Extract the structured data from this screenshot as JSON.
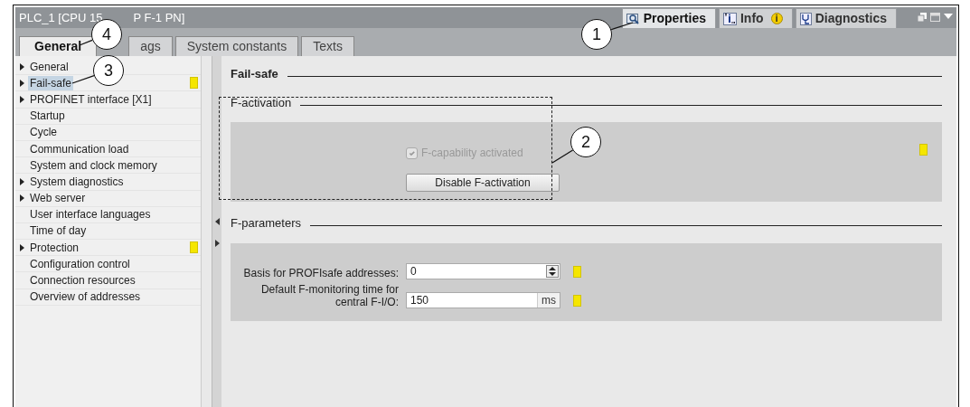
{
  "window": {
    "title_start": "PLC_1 [CPU 15",
    "title_end": "P F-1 PN]"
  },
  "inspector_tabs": [
    {
      "label": "Properties",
      "selected": true
    },
    {
      "label": "Info",
      "selected": false,
      "badge": "i"
    },
    {
      "label": "Diagnostics",
      "selected": false
    }
  ],
  "tabs": [
    {
      "label": "General",
      "selected": true
    },
    {
      "label": "ags",
      "selected": false
    },
    {
      "label": "System constants",
      "selected": false
    },
    {
      "label": "Texts",
      "selected": false
    }
  ],
  "sidebar": {
    "items": [
      {
        "label": "General",
        "expandable": true,
        "selected": false,
        "flagged": false
      },
      {
        "label": "Fail-safe",
        "expandable": true,
        "selected": true,
        "flagged": true
      },
      {
        "label": "PROFINET interface [X1]",
        "expandable": true,
        "selected": false,
        "flagged": false
      },
      {
        "label": "Startup",
        "expandable": false,
        "selected": false,
        "flagged": false
      },
      {
        "label": "Cycle",
        "expandable": false,
        "selected": false,
        "flagged": false
      },
      {
        "label": "Communication load",
        "expandable": false,
        "selected": false,
        "flagged": false
      },
      {
        "label": "System and clock memory",
        "expandable": false,
        "selected": false,
        "flagged": false
      },
      {
        "label": "System diagnostics",
        "expandable": true,
        "selected": false,
        "flagged": false
      },
      {
        "label": "Web server",
        "expandable": true,
        "selected": false,
        "flagged": false
      },
      {
        "label": "User interface languages",
        "expandable": false,
        "selected": false,
        "flagged": false
      },
      {
        "label": "Time of day",
        "expandable": false,
        "selected": false,
        "flagged": false
      },
      {
        "label": "Protection",
        "expandable": true,
        "selected": false,
        "flagged": true
      },
      {
        "label": "Configuration control",
        "expandable": false,
        "selected": false,
        "flagged": false
      },
      {
        "label": "Connection resources",
        "expandable": false,
        "selected": false,
        "flagged": false
      },
      {
        "label": "Overview of addresses",
        "expandable": false,
        "selected": false,
        "flagged": false
      }
    ]
  },
  "section": {
    "title": "Fail-safe",
    "groups": [
      {
        "kind": "activation",
        "title": "F-activation",
        "flagged": true,
        "checkbox": {
          "label": "F-capability activated",
          "checked": true,
          "disabled": true
        },
        "button": "Disable F-activation"
      },
      {
        "kind": "parameters",
        "title": "F-parameters",
        "fields": [
          {
            "kind": "spinner",
            "label": "Basis for PROFIsafe addresses:",
            "value": "0",
            "flagged": true
          },
          {
            "kind": "unit",
            "label": "Default F-monitoring time for central F-I/O:",
            "value": "150",
            "unit": "ms",
            "flagged": true
          }
        ]
      }
    ]
  },
  "callouts": [
    {
      "number": "1"
    },
    {
      "number": "2"
    },
    {
      "number": "3"
    },
    {
      "number": "4"
    }
  ]
}
